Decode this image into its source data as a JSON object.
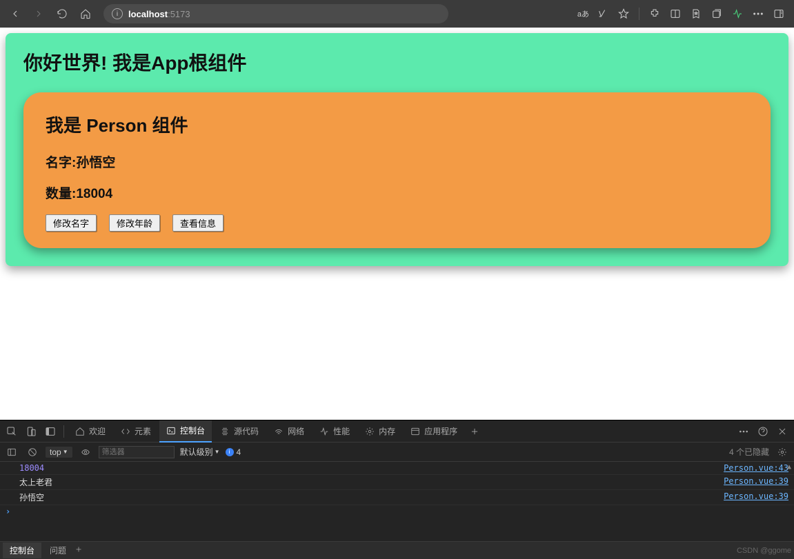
{
  "browser": {
    "url_host": "localhost",
    "url_port": ":5173",
    "lang_label": "aあ"
  },
  "app": {
    "title": "你好世界! 我是App根组件",
    "person": {
      "title": "我是 Person 组件",
      "name_label": "名字:孙悟空",
      "count_label": "数量:18004",
      "buttons": {
        "edit_name": "修改名字",
        "edit_age": "修改年龄",
        "view_info": "查看信息"
      }
    }
  },
  "devtools": {
    "tabs": {
      "welcome": "欢迎",
      "elements": "元素",
      "console": "控制台",
      "sources": "源代码",
      "network": "网络",
      "performance": "性能",
      "memory": "内存",
      "application": "应用程序"
    },
    "toolbar": {
      "context": "top",
      "filter_placeholder": "筛选器",
      "level": "默认级别",
      "badge_count": "4",
      "hidden": "4 个已隐藏"
    },
    "console_rows": [
      {
        "type": "num",
        "msg": "18004",
        "src": "Person.vue:43"
      },
      {
        "type": "str",
        "msg": "太上老君",
        "src": "Person.vue:39"
      },
      {
        "type": "str",
        "msg": "孙悟空",
        "src": "Person.vue:39"
      }
    ],
    "bottom": {
      "console": "控制台",
      "issues": "问题",
      "watermark": "CSDN @ggome"
    }
  }
}
